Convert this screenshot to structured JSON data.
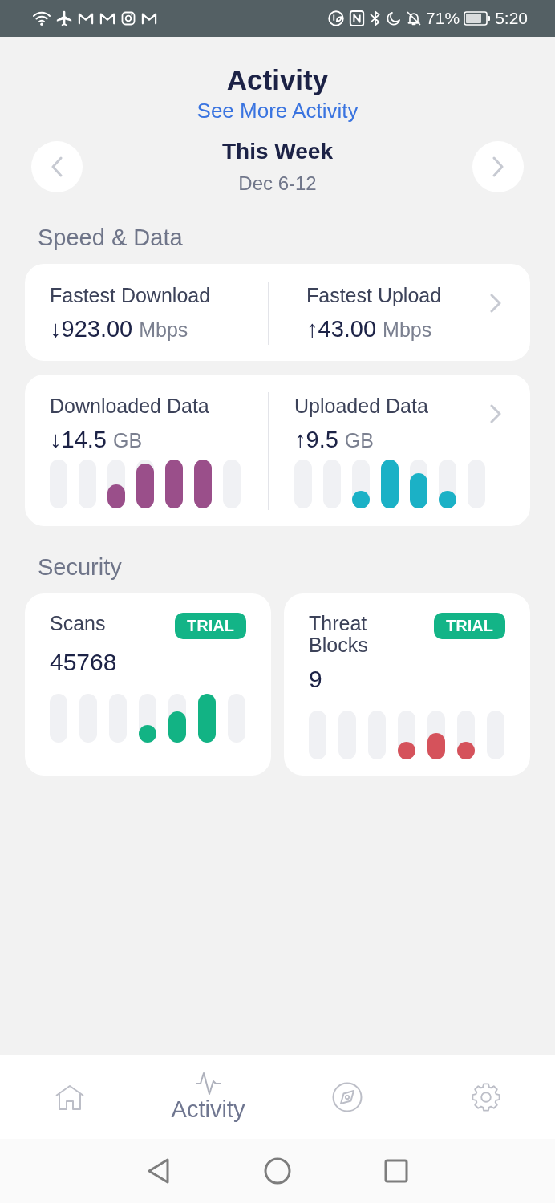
{
  "status_bar": {
    "battery": "71%",
    "time": "5:20"
  },
  "header": {
    "title": "Activity",
    "link": "See More Activity",
    "period": "This Week",
    "dates": "Dec 6-12"
  },
  "speed_data": {
    "heading": "Speed & Data",
    "speeds": [
      {
        "label": "Fastest Download",
        "value": "↓923.00",
        "unit": "Mbps"
      },
      {
        "label": "Fastest Upload",
        "value": "↑43.00",
        "unit": "Mbps"
      }
    ],
    "data": [
      {
        "label": "Downloaded Data",
        "value": "↓14.5",
        "unit": "GB",
        "color": "#9a4f8a"
      },
      {
        "label": "Uploaded Data",
        "value": "↑9.5",
        "unit": "GB",
        "color": "#1bb1c6"
      }
    ]
  },
  "security": {
    "heading": "Security",
    "cards": [
      {
        "label": "Scans",
        "badge": "TRIAL",
        "value": "45768",
        "color": "#12b384"
      },
      {
        "label": "Threat Blocks",
        "badge": "TRIAL",
        "value": "9",
        "color": "#d5525b"
      }
    ]
  },
  "nav": [
    {
      "selected": false
    },
    {
      "label": "Activity",
      "selected": true
    },
    {
      "selected": false
    },
    {
      "selected": false
    }
  ]
}
